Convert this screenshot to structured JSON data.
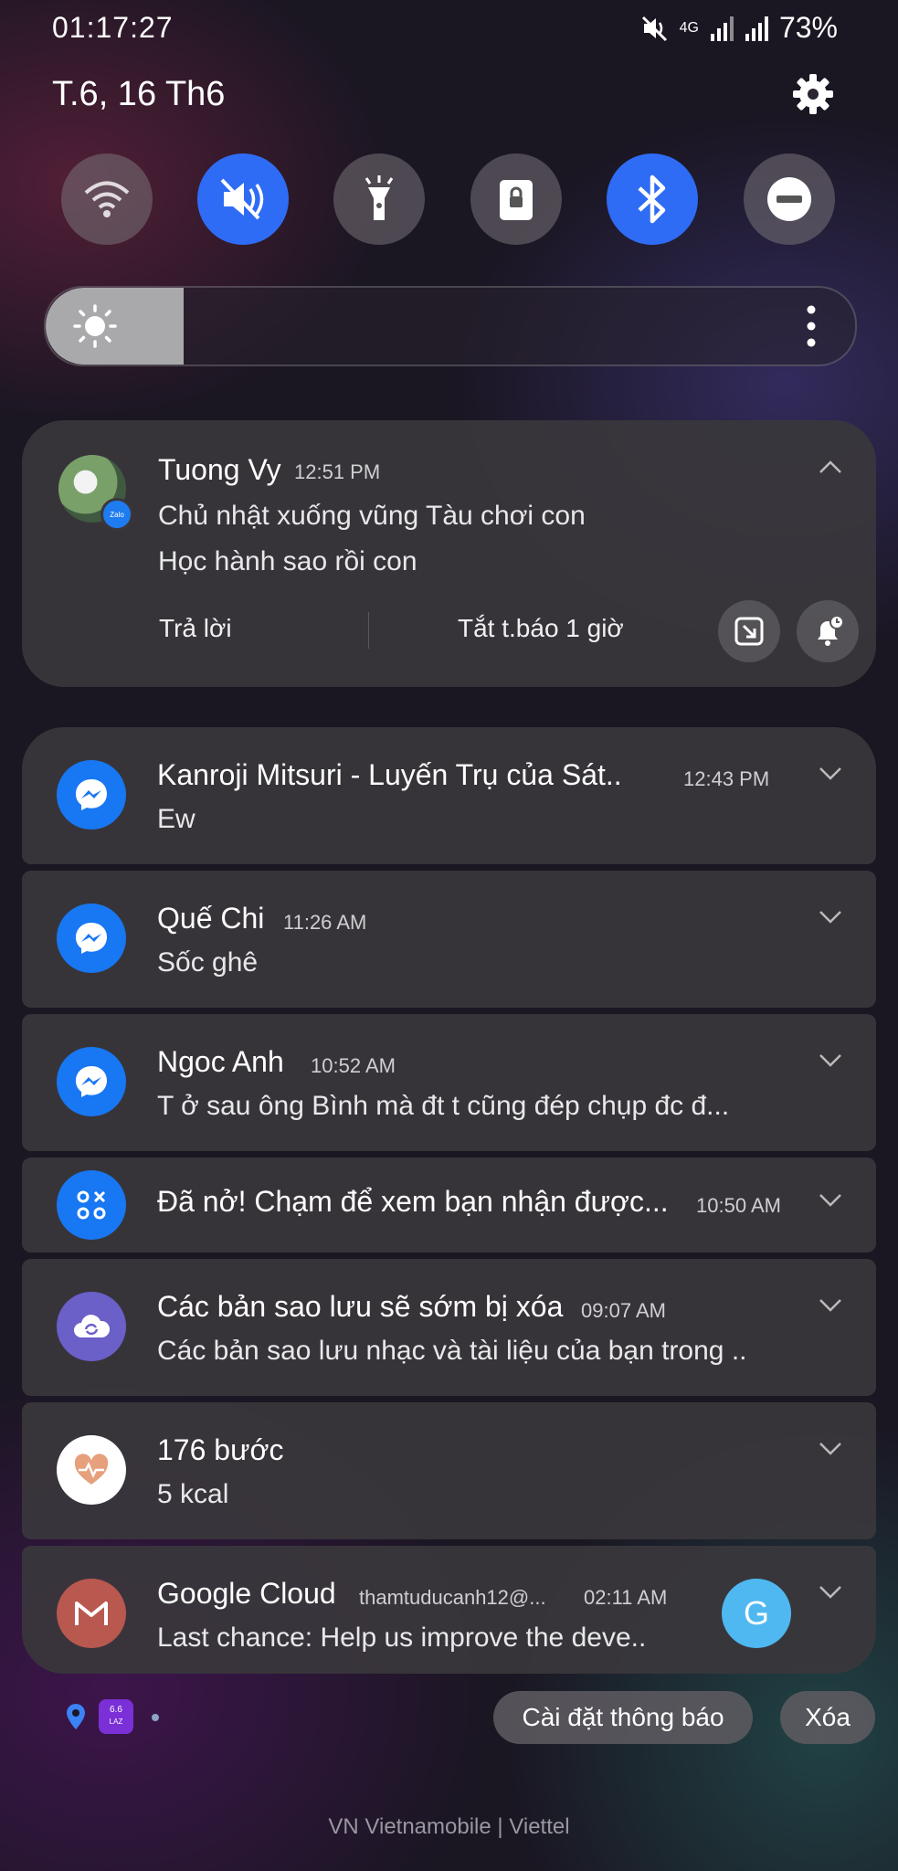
{
  "status_bar": {
    "time": "01:17:27",
    "battery": "73%",
    "network": "4G"
  },
  "header": {
    "date": "T.6, 16 Th6"
  },
  "quick_settings": {
    "tiles": [
      {
        "name": "wifi",
        "on": false
      },
      {
        "name": "sound-mute",
        "on": true
      },
      {
        "name": "flashlight",
        "on": false
      },
      {
        "name": "screen-lock",
        "on": false
      },
      {
        "name": "bluetooth",
        "on": true
      },
      {
        "name": "do-not-disturb",
        "on": false
      }
    ],
    "brightness_level": 0.17
  },
  "notifications": {
    "expanded": {
      "sender": "Tuong Vy",
      "time": "12:51 PM",
      "line1": "Chủ nhật xuống vũng Tàu chơi con",
      "line2": "Học hành sao rồi con",
      "reply_label": "Trả lời",
      "mute_label": "Tắt t.báo 1 giờ",
      "app_badge": "Zalo"
    },
    "items": [
      {
        "title": "Kanroji Mitsuri - Luyến Trụ của Sát..",
        "time": "12:43 PM",
        "body": "Ew",
        "icon": "messenger-icon"
      },
      {
        "title": "Quế Chi",
        "time": "11:26 AM",
        "body": "Sốc ghê",
        "icon": "messenger-icon"
      },
      {
        "title": "Ngoc Anh",
        "time": "10:52 AM",
        "body": "T ở sau ông Bình mà đt t cũng đép chụp đc đ...",
        "icon": "messenger-icon"
      },
      {
        "title": "Đã nở! Chạm để xem bạn nhận được...",
        "time": "10:50 AM",
        "body": "",
        "icon": "apps-grid-icon"
      },
      {
        "title": "Các bản sao lưu sẽ sớm bị xóa",
        "time": "09:07 AM",
        "body": "Các bản sao lưu nhạc và tài liệu của bạn trong ..",
        "icon": "cloud-sync-icon"
      },
      {
        "title": "176 bước",
        "time": "",
        "body": "5 kcal",
        "icon": "health-heart-icon"
      },
      {
        "title": "Google Cloud",
        "account": "thamtuducanh12@...",
        "time": "02:11 AM",
        "body": "Last chance: Help us improve the deve..",
        "icon": "gmail-icon",
        "avatar_letter": "G"
      }
    ]
  },
  "footer": {
    "settings_label": "Cài đặt thông báo",
    "clear_label": "Xóa",
    "small_icon_text": "6.6",
    "small_icon_sub": "LAZ",
    "carrier": "VN Vietnamobile | Viettel"
  },
  "colors": {
    "accent": "#2f6cf5",
    "messenger": "#1877f2",
    "gmail": "#b9584f",
    "cloud": "#6b5fc8",
    "avatar_g": "#4fb8f0"
  }
}
